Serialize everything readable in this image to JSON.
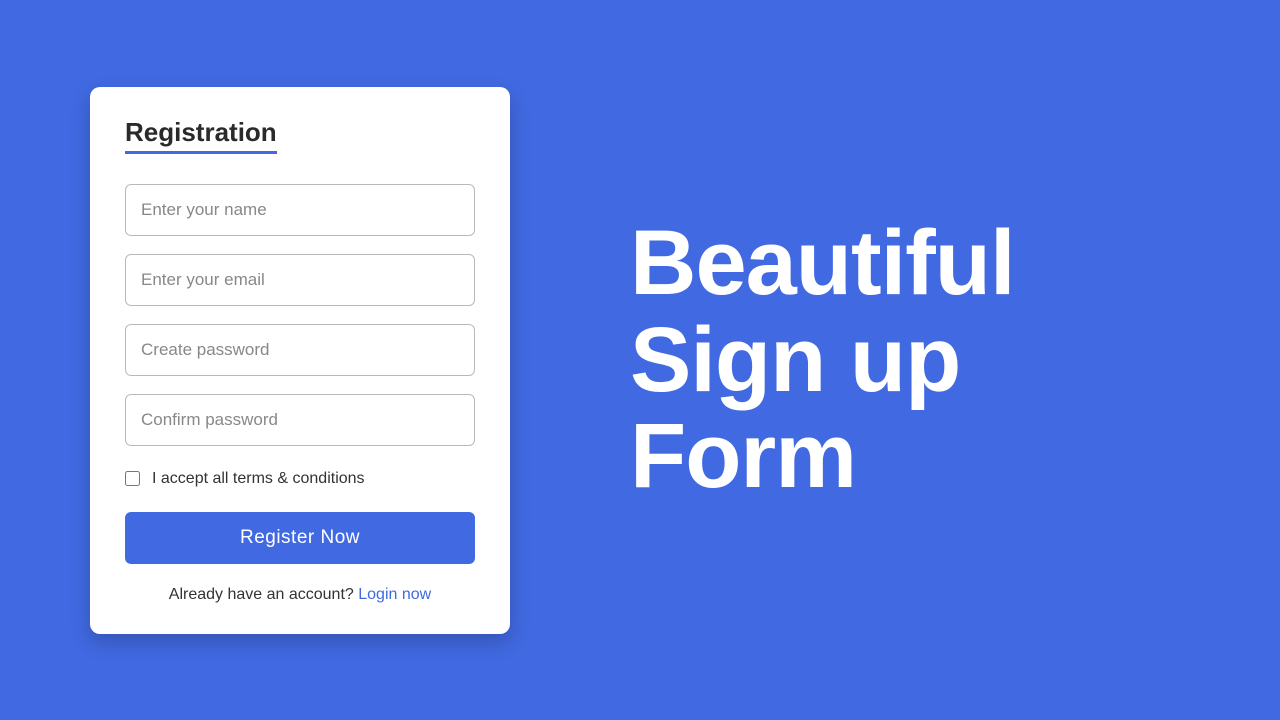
{
  "form": {
    "title": "Registration",
    "name_placeholder": "Enter your name",
    "email_placeholder": "Enter your email",
    "password_placeholder": "Create password",
    "confirm_placeholder": "Confirm password",
    "terms_label": "I accept all terms & conditions",
    "submit_label": "Register Now",
    "login_prompt": "Already have an account? ",
    "login_link": "Login now"
  },
  "hero": {
    "line1": "Beautiful",
    "line2": "Sign up",
    "line3": "Form"
  }
}
